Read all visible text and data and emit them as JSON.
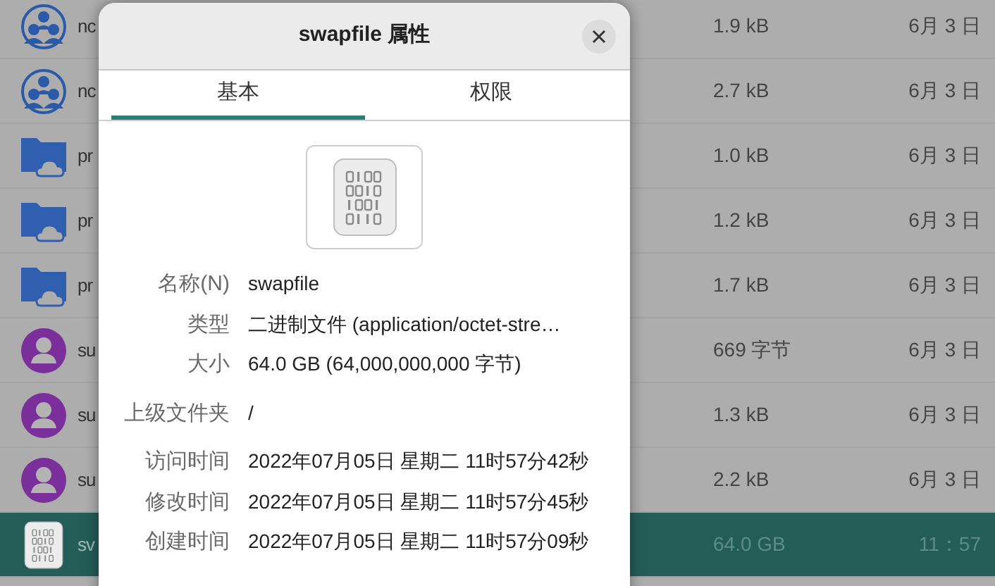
{
  "file_list": {
    "rows": [
      {
        "kind": "network",
        "name": "nc",
        "size": "1.9 kB",
        "modified": "6月 3 日",
        "selected": false
      },
      {
        "kind": "network",
        "name": "nc",
        "size": "2.7 kB",
        "modified": "6月 3 日",
        "selected": false
      },
      {
        "kind": "folder",
        "name": "pr",
        "size": "1.0 kB",
        "modified": "6月 3 日",
        "selected": false
      },
      {
        "kind": "folder",
        "name": "pr",
        "size": "1.2 kB",
        "modified": "6月 3 日",
        "selected": false
      },
      {
        "kind": "folder",
        "name": "pr",
        "size": "1.7 kB",
        "modified": "6月 3 日",
        "selected": false
      },
      {
        "kind": "user",
        "name": "su",
        "size": "669 字节",
        "modified": "6月 3 日",
        "selected": false
      },
      {
        "kind": "user",
        "name": "su",
        "size": "1.3 kB",
        "modified": "6月 3 日",
        "selected": false
      },
      {
        "kind": "user",
        "name": "su",
        "size": "2.2 kB",
        "modified": "6月 3 日",
        "selected": false
      },
      {
        "kind": "binary",
        "name": "sv",
        "size": "64.0 GB",
        "modified": "11：57",
        "selected": true
      }
    ]
  },
  "dialog": {
    "title": "swapfile 属性",
    "tabs": [
      {
        "label": "基本",
        "selected": true
      },
      {
        "label": "权限",
        "selected": false
      }
    ],
    "fields": [
      {
        "label": "名称(N)",
        "value": "swapfile"
      },
      {
        "label": "类型",
        "value": "二进制文件 (application/octet-stre…"
      },
      {
        "label": "大小",
        "value": "64.0 GB (64,000,000,000 字节)"
      },
      {
        "label": "上级文件夹",
        "value": "/"
      },
      {
        "label": "访问时间",
        "value": "2022年07月05日 星期二 11时57分42秒"
      },
      {
        "label": "修改时间",
        "value": "2022年07月05日 星期二 11时57分45秒"
      },
      {
        "label": "创建时间",
        "value": "2022年07月05日 星期二 11时57分09秒"
      }
    ]
  }
}
